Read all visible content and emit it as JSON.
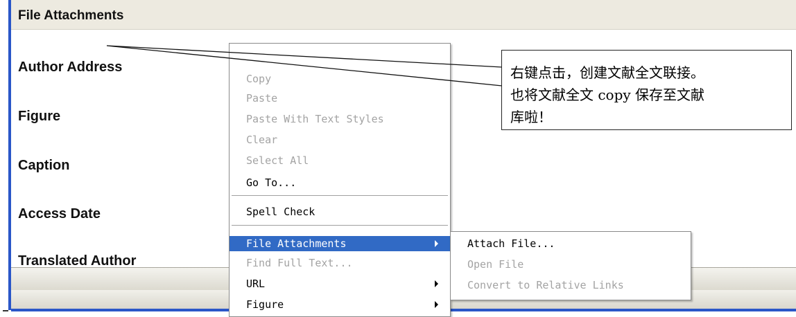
{
  "header": {
    "title": "File Attachments"
  },
  "fields": [
    {
      "label": "Author Address"
    },
    {
      "label": "Figure"
    },
    {
      "label": "Caption"
    },
    {
      "label": "Access Date"
    },
    {
      "label": "Translated Author"
    }
  ],
  "context_menu": {
    "items": [
      {
        "label": "Copy",
        "enabled": false
      },
      {
        "label": "Paste",
        "enabled": false
      },
      {
        "label": "Paste With Text Styles",
        "enabled": false
      },
      {
        "label": "Clear",
        "enabled": false
      },
      {
        "label": "Select All",
        "enabled": false
      },
      {
        "label": "Go To...",
        "enabled": true
      },
      {
        "label": "Spell Check",
        "enabled": true
      },
      {
        "label": "File Attachments",
        "enabled": true,
        "selected": true,
        "submenu": true
      },
      {
        "label": "Find Full Text...",
        "enabled": false
      },
      {
        "label": "URL",
        "enabled": true,
        "submenu": true
      },
      {
        "label": "Figure",
        "enabled": true,
        "submenu": true
      }
    ]
  },
  "submenu": {
    "items": [
      {
        "label": "Attach File...",
        "enabled": true
      },
      {
        "label": "Open File",
        "enabled": false
      },
      {
        "label": "Convert to Relative Links",
        "enabled": false
      }
    ]
  },
  "callout": {
    "lines": [
      "右键点击，创建文献全文联接。",
      "也将文献全文 copy 保存至文献",
      "库啦！"
    ]
  },
  "colors": {
    "selection": "#316ac5",
    "disabled_text": "#a3a3a3",
    "window_border": "#2a57c8"
  }
}
